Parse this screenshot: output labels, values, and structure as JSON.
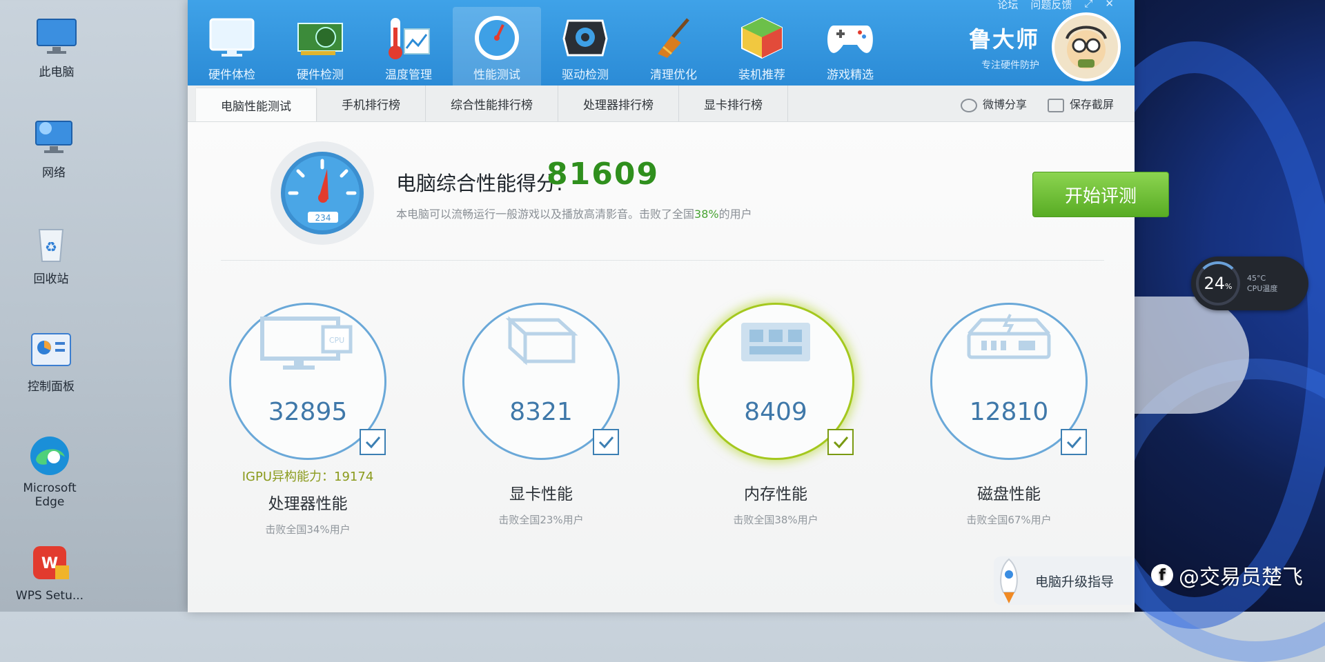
{
  "desktop": {
    "icons": [
      {
        "label": "此电脑"
      },
      {
        "label": "网络"
      },
      {
        "label": "回收站"
      },
      {
        "label": "控制面板"
      },
      {
        "label": "Microsoft\nEdge"
      },
      {
        "label": "WPS Setu..."
      }
    ],
    "cpu_widget": {
      "percent": "24",
      "unit": "%",
      "temp": "45°C",
      "label": "CPU温度"
    },
    "watermark": "@交易员楚飞"
  },
  "window": {
    "title_links": [
      "论坛",
      "问题反馈"
    ],
    "nav": [
      {
        "label": "硬件体检"
      },
      {
        "label": "硬件检测"
      },
      {
        "label": "温度管理"
      },
      {
        "label": "性能测试",
        "active": true
      },
      {
        "label": "驱动检测"
      },
      {
        "label": "清理优化"
      },
      {
        "label": "装机推荐"
      },
      {
        "label": "游戏精选"
      }
    ],
    "brand": {
      "name": "鲁大师",
      "slogan": "专注硬件防护"
    },
    "tabs": [
      {
        "label": "电脑性能测试",
        "active": true
      },
      {
        "label": "手机排行榜"
      },
      {
        "label": "综合性能排行榜"
      },
      {
        "label": "处理器排行榜"
      },
      {
        "label": "显卡排行榜"
      }
    ],
    "actions": {
      "share": "微博分享",
      "screenshot": "保存截屏"
    },
    "summary": {
      "label": "电脑综合性能得分:",
      "score": "81609",
      "desc_pre": "本电脑可以流畅运行一般游戏以及播放高清影音。击败了全国",
      "desc_pct": "38%",
      "desc_post": "的用户",
      "gauge_text": "234",
      "start_button": "开始评测"
    },
    "metrics": [
      {
        "value": "32895",
        "sub": "IGPU异构能力：19174",
        "name": "处理器性能",
        "desc": "击败全国34%用户"
      },
      {
        "value": "8321",
        "sub": "",
        "name": "显卡性能",
        "desc": "击败全国23%用户"
      },
      {
        "value": "8409",
        "sub": "",
        "name": "内存性能",
        "desc": "击败全国38%用户"
      },
      {
        "value": "12810",
        "sub": "",
        "name": "磁盘性能",
        "desc": "击败全国67%用户"
      }
    ],
    "upgrade_label": "电脑升级指导"
  },
  "colors": {
    "accent_blue": "#2b8bd6",
    "score_green": "#2f8f1d",
    "button_green": "#58ac24"
  }
}
